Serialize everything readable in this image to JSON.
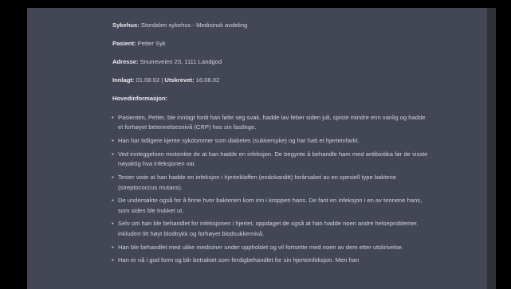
{
  "document": {
    "fields": [
      {
        "label": "Sykehus:",
        "value": "Stordalen sykehus - Medisinsk avdeling"
      },
      {
        "label": "Pasient:",
        "value": "Petter Syk"
      },
      {
        "label": "Adresse:",
        "value": "Snurreveien 23, 1111 Landgod"
      }
    ],
    "dates": {
      "admitted_label": "Innlagt:",
      "admitted_value": "01.08.02",
      "separator": "|",
      "discharged_label": "Utskrevet:",
      "discharged_value": "16.08.02"
    },
    "section_title": "Hovedinformasjon:",
    "bullet_marker": "•",
    "bullets": [
      "Pasienten, Petter, ble innlagt fordi han følte seg svak, hadde lav feber siden juli, spiste mindre enn vanlig og hadde et forhøyet betennelsesnivå (CRP) hos sin fastlege.",
      "Han har tidligere kjente sykdommer som diabetes (sukkersyke) og har hatt et hjerteinfarkt.",
      "Ved innleggelsen mistenkte de at han hadde en infeksjon. De begynte å behandle ham med antibiotika før de visste nøyaktig hva infeksjonen var.",
      "Tester viste at han hadde en infeksjon i hjerteklaffen (endokarditt) forårsaket av en spesiell type bakterie (streptococcus mutans).",
      "De undersøkte også for å finne hvor bakterien kom inn i kroppen hans. De fant en infeksjon i en av tennene hans, som siden ble trukket ut.",
      "Selv om han ble behandlet for infeksjonen i hjertet, oppdaget de også at han hadde noen andre helseproblemer, inkludert litt høyt blodtrykk og forhøyet blodsukkernivå.",
      "Han ble behandlet med ulike medisiner under oppholdet og vil fortsette med noen av dem etter utskrivelse.",
      "Han er nå i god form og blir betraktet som ferdigbehandlet for sin hjerteinfeksjon. Men han"
    ]
  },
  "colors": {
    "background": "#000000",
    "panel": "#434654",
    "text": "#d1d2d9",
    "strong_text": "#ececf1"
  }
}
